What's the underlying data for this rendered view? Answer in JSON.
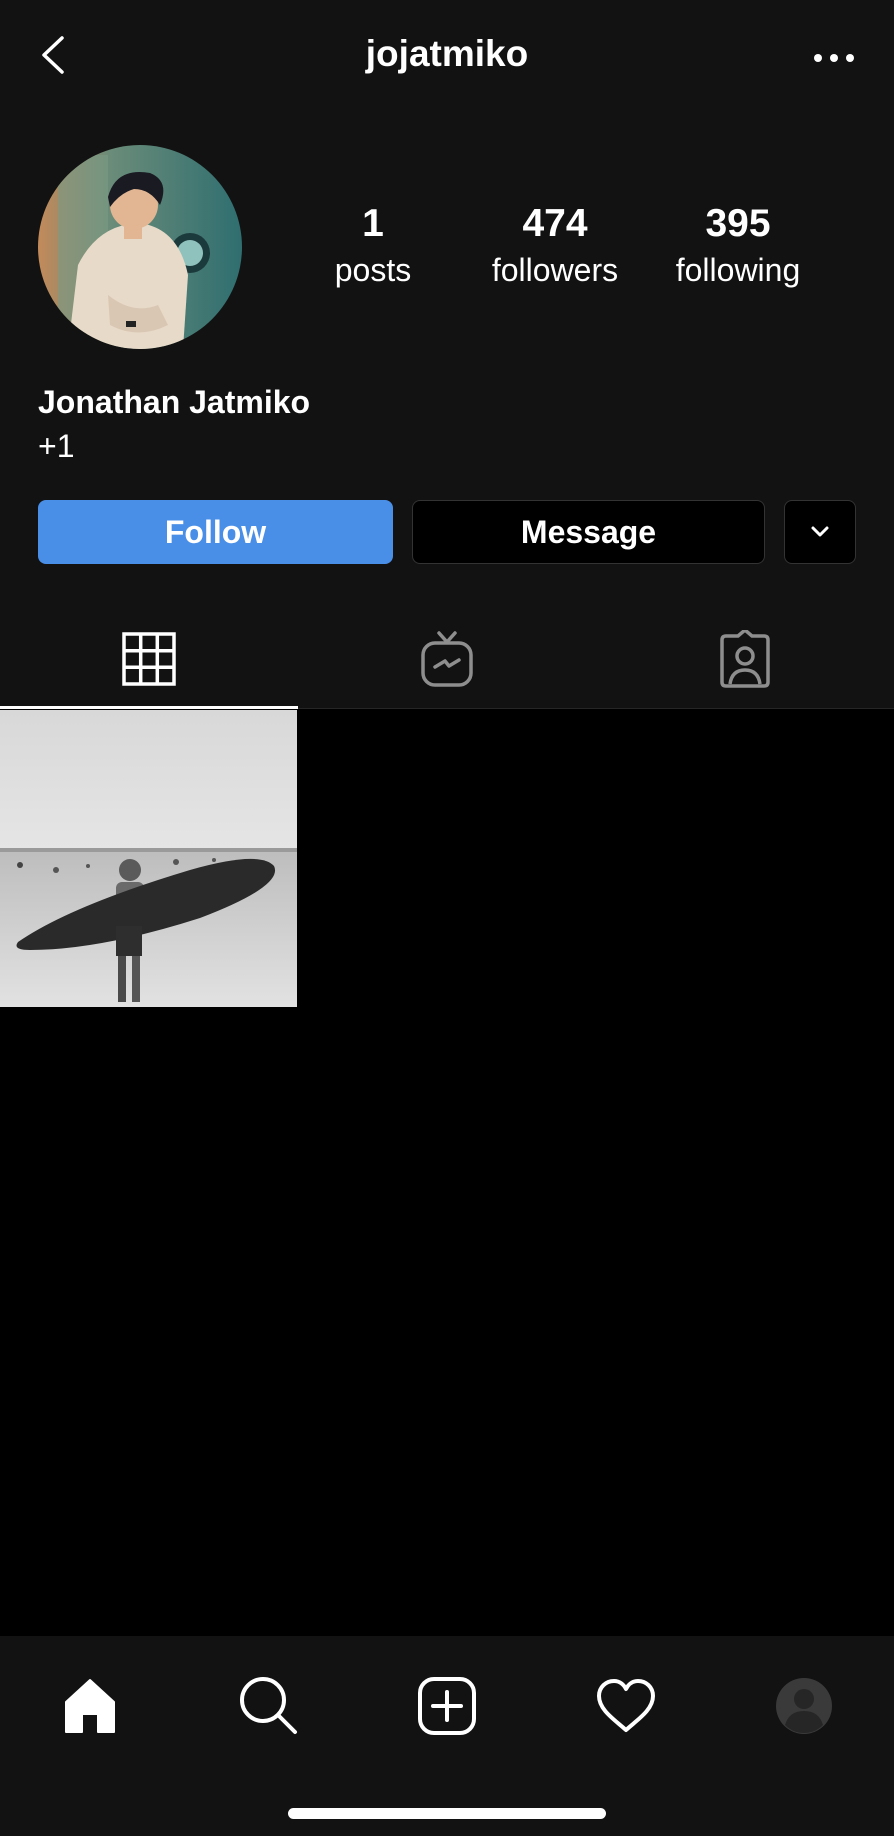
{
  "header": {
    "username": "jojatmiko",
    "back_icon": "chevron-left-icon",
    "more_icon": "ellipsis-icon"
  },
  "profile": {
    "stats": [
      {
        "value": "1",
        "label": "posts"
      },
      {
        "value": "474",
        "label": "followers"
      },
      {
        "value": "395",
        "label": "following"
      }
    ],
    "display_name": "Jonathan Jatmiko",
    "bio": "+1"
  },
  "actions": {
    "follow_label": "Follow",
    "message_label": "Message",
    "more_icon": "chevron-down-icon"
  },
  "tabs": [
    {
      "name": "grid",
      "icon": "grid-icon",
      "active": true
    },
    {
      "name": "igtv",
      "icon": "igtv-icon",
      "active": false
    },
    {
      "name": "tagged",
      "icon": "tagged-person-icon",
      "active": false
    }
  ],
  "bottom_nav": [
    {
      "name": "home",
      "icon": "home-icon"
    },
    {
      "name": "search",
      "icon": "search-icon"
    },
    {
      "name": "create",
      "icon": "add-post-icon"
    },
    {
      "name": "activity",
      "icon": "heart-icon"
    },
    {
      "name": "profile",
      "icon": "profile-avatar-icon"
    }
  ],
  "colors": {
    "background": "#000000",
    "surface": "#121212",
    "accent": "#4a8fe7",
    "text": "#ffffff"
  }
}
